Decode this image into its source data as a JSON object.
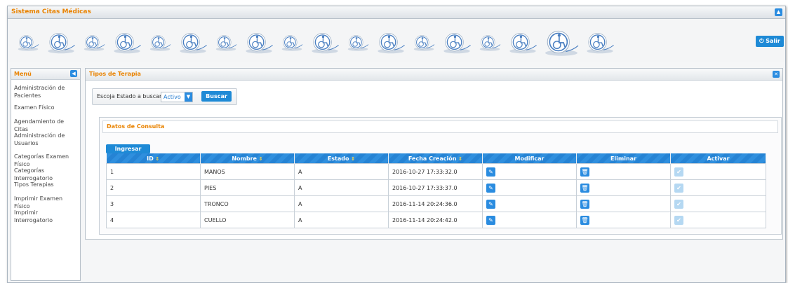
{
  "app": {
    "title": "Sistema Citas Médicas",
    "logout_label": "Salir",
    "logout_icon": "power-icon",
    "accent": "#e98300",
    "primary": "#1e8ad6"
  },
  "banner": {
    "icons": [
      "wheelchair-icon"
    ]
  },
  "sidebar": {
    "title": "Menú",
    "items": [
      {
        "label": "Administración de Pacientes"
      },
      {
        "label": "Examen Físico"
      },
      {
        "label": "Agendamiento de Citas"
      },
      {
        "label": "Administración de Usuarios"
      },
      {
        "label": "Categorías Examen Físico"
      },
      {
        "label": "Categorías Interrogatorio"
      },
      {
        "label": "Tipos Terapias"
      },
      {
        "label": "Imprimir Examen Físico"
      },
      {
        "label": "Imprimir Interrogatorio"
      }
    ]
  },
  "panel": {
    "title": "Tipos de Terapia",
    "filter_label": "Escoja Estado a buscar",
    "filter_value": "Activo",
    "search_label": "Buscar",
    "results_title": "Datos de Consulta",
    "new_label": "Ingresar nuevo"
  },
  "table": {
    "columns": [
      "ID",
      "Nombre",
      "Estado",
      "Fecha Creación",
      "Modificar",
      "Eliminar",
      "Activar"
    ],
    "rows": [
      [
        "1",
        "MANOS",
        "A",
        "2016-10-27 17:33:32.0"
      ],
      [
        "2",
        "PIES",
        "A",
        "2016-10-27 17:33:37.0"
      ],
      [
        "3",
        "TRONCO",
        "A",
        "2016-11-14 20:24:36.0"
      ],
      [
        "4",
        "CUELLO",
        "A",
        "2016-11-14 20:24:42.0"
      ]
    ]
  }
}
